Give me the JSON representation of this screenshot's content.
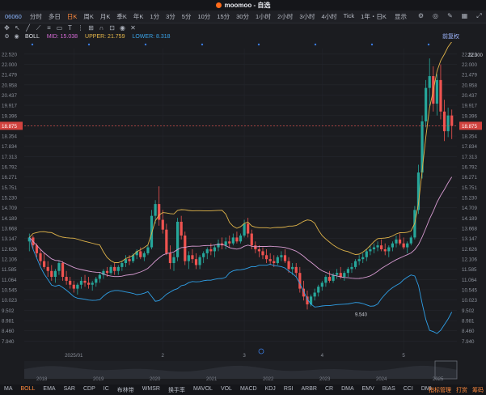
{
  "window": {
    "title": "moomoo - 自选"
  },
  "periods": {
    "code": "06060",
    "items": [
      "分时",
      "多日",
      "日K",
      "周K",
      "月K",
      "季K",
      "年K",
      "1分",
      "3分",
      "5分",
      "10分",
      "15分",
      "30分",
      "1小时",
      "2小时",
      "3小时",
      "4小时",
      "Tick",
      "1年・日K"
    ],
    "active_index": 2,
    "right_label": "显示"
  },
  "indicator": {
    "name": "BOLL",
    "mid_label": "MID: 15.038",
    "upper_label": "UPPER: 21.759",
    "lower_label": "LOWER: 8.318",
    "rhs": "前复权"
  },
  "bottom": {
    "indicators": [
      "MA",
      "BOLL",
      "EMA",
      "SAR",
      "CDP",
      "IC",
      "布林带",
      "WMSR",
      "换手率",
      "MAVOL",
      "VOL",
      "MACD",
      "KDJ",
      "RSI",
      "ARBR",
      "CR",
      "DMA",
      "EMV",
      "BIAS",
      "CCI",
      "DMI"
    ],
    "active_index": 1,
    "right": [
      "指标管理",
      "打赏",
      "筹码"
    ]
  },
  "chart_data": {
    "type": "candlestick",
    "title": "",
    "ylim": [
      7.5,
      22.8
    ],
    "yticks": [
      "22.520",
      "22.000",
      "21.479",
      "20.958",
      "20.437",
      "19.917",
      "19.396",
      "18.875",
      "18.354",
      "17.834",
      "17.313",
      "16.792",
      "16.271",
      "15.751",
      "15.230",
      "14.709",
      "14.189",
      "13.668",
      "13.147",
      "12.626",
      "12.106",
      "11.585",
      "11.064",
      "10.545",
      "10.023",
      "9.502",
      "8.981",
      "8.460",
      "7.940"
    ],
    "current_price": "18.875",
    "x_labels": [
      {
        "text": "2025/01",
        "i": 12
      },
      {
        "text": "2",
        "i": 36
      },
      {
        "text": "3",
        "i": 58
      },
      {
        "text": "4",
        "i": 79
      },
      {
        "text": "5",
        "i": 101
      },
      {
        "text": "6",
        "i": 127
      }
    ],
    "annotations": [
      {
        "text": "22.300",
        "i": 124,
        "y": 22.3
      },
      {
        "text": "9.540",
        "i": 87,
        "y": 9.54
      }
    ],
    "timeline_years": [
      "2018",
      "2019",
      "2020",
      "2021",
      "2022",
      "2023",
      "2024",
      "2025"
    ],
    "colors": {
      "up": "#26a69a",
      "down": "#ef5350",
      "mid": "#d79bd1",
      "upper": "#e0b44a",
      "lower": "#2f9fe6",
      "current": "#ef5350"
    },
    "candles": [
      [
        13.0,
        13.4,
        12.5,
        13.2
      ],
      [
        13.2,
        13.3,
        12.6,
        12.8
      ],
      [
        12.8,
        12.9,
        12.2,
        12.4
      ],
      [
        12.4,
        12.6,
        11.8,
        12.0
      ],
      [
        12.0,
        12.4,
        11.6,
        11.7
      ],
      [
        11.7,
        12.0,
        11.2,
        11.5
      ],
      [
        11.5,
        11.8,
        11.0,
        11.2
      ],
      [
        11.2,
        11.6,
        10.9,
        11.5
      ],
      [
        11.5,
        12.0,
        11.3,
        11.9
      ],
      [
        11.9,
        12.0,
        11.0,
        11.2
      ],
      [
        11.2,
        11.5,
        10.8,
        11.0
      ],
      [
        11.0,
        11.2,
        10.6,
        10.8
      ],
      [
        10.8,
        11.0,
        10.4,
        10.6
      ],
      [
        10.6,
        10.9,
        10.3,
        10.8
      ],
      [
        10.8,
        11.2,
        10.6,
        11.0
      ],
      [
        11.0,
        11.3,
        10.7,
        10.9
      ],
      [
        10.9,
        11.2,
        10.6,
        10.8
      ],
      [
        10.8,
        11.0,
        10.5,
        10.9
      ],
      [
        10.9,
        11.2,
        10.7,
        11.1
      ],
      [
        11.1,
        11.4,
        10.9,
        11.3
      ],
      [
        11.3,
        11.6,
        11.1,
        11.5
      ],
      [
        11.5,
        11.7,
        11.2,
        11.4
      ],
      [
        11.4,
        11.8,
        11.3,
        11.7
      ],
      [
        11.7,
        11.9,
        11.3,
        11.5
      ],
      [
        11.5,
        11.8,
        11.3,
        11.7
      ],
      [
        11.7,
        12.0,
        11.5,
        11.9
      ],
      [
        11.9,
        12.3,
        11.7,
        12.1
      ],
      [
        12.1,
        12.3,
        11.8,
        12.0
      ],
      [
        12.0,
        12.4,
        11.9,
        12.3
      ],
      [
        12.3,
        12.6,
        12.1,
        12.5
      ],
      [
        12.5,
        12.7,
        12.1,
        12.2
      ],
      [
        12.2,
        12.5,
        12.0,
        12.4
      ],
      [
        12.4,
        12.8,
        12.3,
        12.7
      ],
      [
        12.7,
        14.6,
        12.6,
        14.3
      ],
      [
        14.3,
        15.1,
        13.9,
        14.9
      ],
      [
        14.9,
        15.8,
        13.8,
        14.1
      ],
      [
        14.1,
        14.6,
        13.4,
        13.6
      ],
      [
        13.6,
        13.9,
        12.3,
        12.4
      ],
      [
        12.4,
        12.8,
        11.6,
        11.9
      ],
      [
        11.9,
        12.4,
        11.5,
        12.2
      ],
      [
        12.2,
        14.2,
        12.0,
        14.0
      ],
      [
        14.0,
        14.3,
        13.1,
        13.3
      ],
      [
        13.3,
        13.5,
        11.8,
        12.0
      ],
      [
        12.0,
        12.5,
        11.6,
        12.3
      ],
      [
        12.3,
        12.6,
        11.9,
        12.1
      ],
      [
        12.1,
        12.4,
        11.6,
        11.8
      ],
      [
        11.8,
        12.3,
        11.6,
        12.2
      ],
      [
        12.2,
        12.5,
        11.9,
        12.4
      ],
      [
        12.4,
        12.7,
        12.1,
        12.6
      ],
      [
        12.6,
        12.9,
        12.3,
        12.5
      ],
      [
        12.5,
        12.8,
        12.2,
        12.7
      ],
      [
        12.7,
        13.1,
        12.5,
        12.9
      ],
      [
        12.9,
        13.2,
        12.6,
        12.8
      ],
      [
        12.8,
        13.2,
        12.6,
        13.0
      ],
      [
        13.0,
        13.3,
        12.7,
        12.9
      ],
      [
        12.9,
        13.4,
        12.8,
        13.2
      ],
      [
        13.2,
        13.5,
        12.9,
        13.0
      ],
      [
        13.0,
        13.4,
        12.9,
        13.3
      ],
      [
        13.3,
        14.1,
        13.2,
        13.9
      ],
      [
        13.9,
        14.2,
        13.2,
        13.4
      ],
      [
        13.4,
        13.6,
        12.6,
        12.8
      ],
      [
        12.8,
        13.0,
        12.4,
        12.6
      ],
      [
        12.6,
        12.8,
        12.2,
        12.5
      ],
      [
        12.5,
        12.7,
        12.1,
        12.3
      ],
      [
        12.3,
        12.6,
        11.9,
        12.1
      ],
      [
        12.1,
        12.4,
        11.8,
        12.0
      ],
      [
        12.0,
        12.3,
        11.7,
        11.9
      ],
      [
        11.9,
        12.3,
        11.8,
        12.2
      ],
      [
        12.2,
        12.5,
        12.0,
        12.3
      ],
      [
        12.3,
        12.6,
        11.9,
        12.0
      ],
      [
        12.0,
        12.2,
        11.4,
        11.6
      ],
      [
        11.6,
        11.9,
        11.3,
        11.7
      ],
      [
        11.7,
        11.9,
        11.2,
        11.4
      ],
      [
        11.4,
        11.7,
        10.4,
        10.6
      ],
      [
        10.6,
        11.0,
        10.0,
        10.2
      ],
      [
        10.2,
        10.5,
        9.54,
        9.8
      ],
      [
        9.8,
        10.3,
        9.7,
        10.2
      ],
      [
        10.2,
        10.6,
        10.0,
        10.4
      ],
      [
        10.4,
        10.8,
        10.2,
        10.7
      ],
      [
        10.7,
        11.0,
        10.5,
        10.9
      ],
      [
        10.9,
        11.3,
        10.7,
        11.2
      ],
      [
        11.2,
        11.5,
        10.9,
        11.0
      ],
      [
        11.0,
        11.4,
        10.9,
        11.3
      ],
      [
        11.3,
        11.6,
        11.1,
        11.4
      ],
      [
        11.4,
        11.7,
        11.1,
        11.2
      ],
      [
        11.2,
        11.5,
        11.0,
        11.4
      ],
      [
        11.4,
        11.7,
        11.2,
        11.6
      ],
      [
        11.6,
        11.9,
        11.4,
        11.7
      ],
      [
        11.7,
        12.1,
        11.6,
        12.0
      ],
      [
        12.0,
        12.3,
        11.8,
        12.1
      ],
      [
        12.1,
        12.4,
        11.9,
        12.2
      ],
      [
        12.2,
        12.6,
        12.0,
        12.5
      ],
      [
        12.5,
        12.8,
        12.3,
        12.6
      ],
      [
        12.6,
        12.9,
        12.4,
        12.7
      ],
      [
        12.7,
        13.0,
        12.5,
        12.8
      ],
      [
        12.8,
        13.1,
        12.5,
        12.6
      ],
      [
        12.6,
        12.9,
        12.3,
        12.5
      ],
      [
        12.5,
        12.8,
        12.2,
        12.7
      ],
      [
        12.7,
        13.0,
        12.5,
        12.9
      ],
      [
        12.9,
        13.3,
        12.7,
        13.1
      ],
      [
        13.1,
        13.4,
        12.8,
        12.9
      ],
      [
        12.9,
        13.2,
        12.6,
        12.7
      ],
      [
        12.7,
        13.0,
        12.4,
        12.9
      ],
      [
        12.9,
        13.3,
        12.8,
        13.2
      ],
      [
        13.2,
        14.8,
        13.1,
        14.6
      ],
      [
        14.6,
        16.9,
        14.4,
        16.5
      ],
      [
        16.5,
        19.4,
        16.2,
        19.1
      ],
      [
        19.1,
        21.2,
        18.8,
        20.8
      ],
      [
        20.8,
        22.3,
        19.9,
        21.4
      ],
      [
        21.4,
        21.9,
        19.6,
        20.0
      ],
      [
        20.0,
        21.5,
        19.4,
        21.2
      ],
      [
        21.2,
        22.0,
        19.2,
        19.6
      ],
      [
        19.6,
        20.2,
        18.1,
        18.6
      ],
      [
        18.6,
        19.8,
        18.3,
        19.4
      ],
      [
        19.4,
        19.7,
        18.2,
        18.875
      ]
    ]
  }
}
